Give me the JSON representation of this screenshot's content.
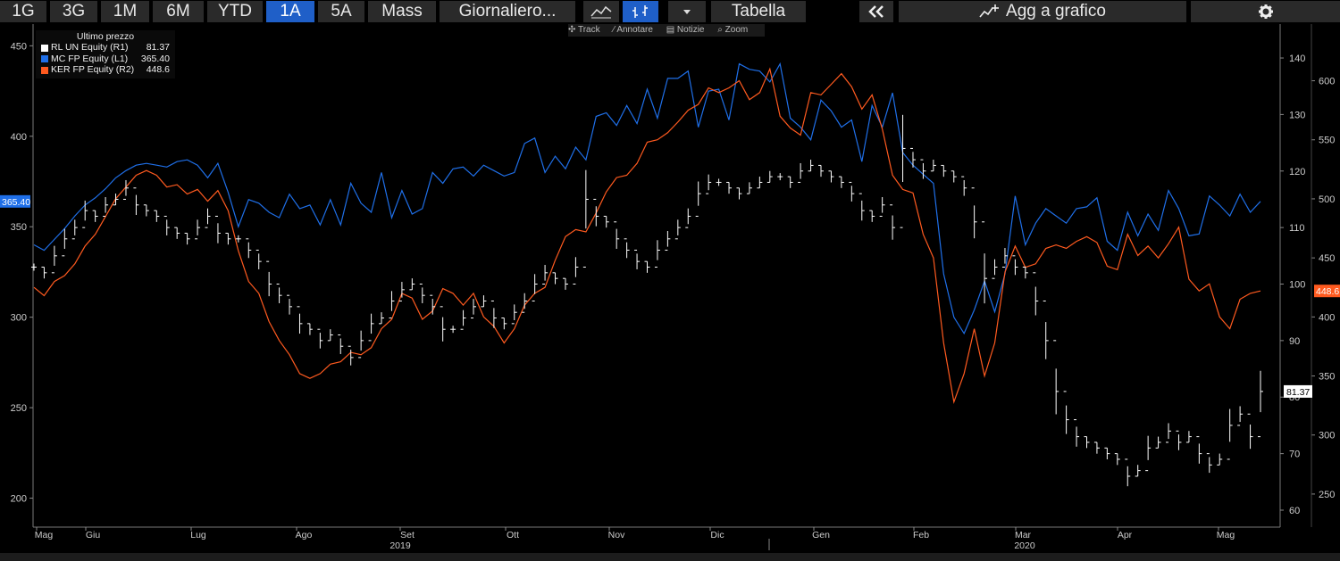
{
  "toolbar": {
    "buttons": [
      {
        "label": "1G"
      },
      {
        "label": "3G"
      },
      {
        "label": "1M"
      },
      {
        "label": "6M"
      },
      {
        "label": "YTD"
      },
      {
        "label": "1A",
        "active": true
      },
      {
        "label": "5A"
      },
      {
        "label": "Mass"
      },
      {
        "label": "Giornaliero..."
      }
    ],
    "icons": [
      "line-chart-icon",
      "bar-chart-icon",
      "dropdown-icon"
    ],
    "table_label": "Tabella",
    "collapse_icon": "double-chevron-left-icon",
    "add_chart_icon": "chart-add-icon",
    "add_chart_label": "Agg a grafico",
    "settings_icon": "gear-icon"
  },
  "subtools": [
    "Track",
    "Annotare",
    "Notizie",
    "Zoom"
  ],
  "legend": {
    "title": "Ultimo prezzo",
    "items": [
      {
        "name": "RL UN Equity  (R1)",
        "value": "81.37",
        "color": "#ffffff"
      },
      {
        "name": "MC FP Equity  (L1)",
        "value": "365.40",
        "color": "#1f6fe8"
      },
      {
        "name": "KER FP Equity  (R2)",
        "value": "448.6",
        "color": "#ff5a1f"
      }
    ]
  },
  "chart_data": {
    "type": "line",
    "x_labels": [
      "Mag",
      "Giu",
      "Lug",
      "Ago",
      "Set",
      "Ott",
      "Nov",
      "Dic",
      "Gen",
      "Feb",
      "Mar",
      "Apr",
      "Mag"
    ],
    "year_labels": [
      "2019",
      "2020"
    ],
    "left_axis": {
      "ticks": [
        200,
        250,
        300,
        350,
        400,
        450
      ],
      "ylim": [
        184,
        462
      ],
      "last_label": "365.40",
      "color": "#1f6fe8"
    },
    "right_axis_r1": {
      "ticks": [
        60,
        70,
        80,
        90,
        100,
        110,
        120,
        130,
        140
      ],
      "ylim": [
        57,
        146
      ],
      "last_label": "81.37"
    },
    "right_axis_r2": {
      "ticks": [
        250,
        300,
        350,
        400,
        450,
        500,
        550,
        600
      ],
      "ylim": [
        222,
        648
      ],
      "last_label": "448.6",
      "color": "#ff5a1f"
    },
    "series": [
      {
        "name": "MC FP Equity",
        "axis": "left",
        "color": "#1f6fe8",
        "values": [
          340,
          337,
          343,
          349,
          356,
          362,
          366,
          371,
          377,
          381,
          384,
          385,
          384,
          383,
          386,
          387,
          384,
          377,
          385,
          369,
          350,
          365,
          363,
          358,
          355,
          368,
          360,
          362,
          351,
          365,
          351,
          374,
          363,
          358,
          380,
          355,
          370,
          357,
          360,
          380,
          374,
          382,
          383,
          378,
          384,
          381,
          378,
          380,
          396,
          399,
          380,
          389,
          382,
          394,
          387,
          411,
          413,
          406,
          417,
          407,
          426,
          410,
          432,
          432,
          436,
          405,
          425,
          426,
          409,
          440,
          437,
          436,
          430,
          440,
          410,
          405,
          398,
          420,
          414,
          405,
          409,
          386,
          417,
          405,
          424,
          391,
          384,
          379,
          374,
          324,
          300,
          291,
          304,
          320,
          303,
          324,
          367,
          340,
          352,
          360,
          356,
          352,
          360,
          361,
          366,
          342,
          337,
          358,
          345,
          357,
          348,
          370,
          360,
          345,
          346,
          367,
          362,
          356,
          368,
          358,
          364
        ]
      },
      {
        "name": "KER FP Equity",
        "axis": "r2",
        "color": "#ff5a1f",
        "values": [
          425,
          418,
          430,
          435,
          445,
          460,
          470,
          485,
          500,
          510,
          520,
          524,
          520,
          510,
          512,
          504,
          508,
          498,
          507,
          490,
          456,
          430,
          420,
          396,
          380,
          368,
          352,
          348,
          352,
          360,
          362,
          370,
          368,
          374,
          390,
          398,
          420,
          416,
          398,
          405,
          424,
          420,
          410,
          420,
          400,
          392,
          378,
          390,
          410,
          420,
          425,
          448,
          468,
          474,
          472,
          488,
          506,
          518,
          520,
          530,
          548,
          550,
          556,
          565,
          575,
          580,
          594,
          590,
          594,
          600,
          584,
          590,
          610,
          570,
          560,
          554,
          590,
          588,
          597,
          606,
          595,
          576,
          588,
          559,
          520,
          508,
          505,
          470,
          450,
          378,
          328,
          352,
          390,
          350,
          378,
          438,
          460,
          442,
          445,
          458,
          461,
          458,
          464,
          468,
          463,
          443,
          440,
          470,
          452,
          460,
          450,
          462,
          476,
          432,
          422,
          428,
          400,
          390,
          415,
          420,
          422
        ]
      },
      {
        "name": "RL UN Equity",
        "axis": "r1",
        "color": "#ffffff",
        "values": [
          103,
          102,
          105,
          108,
          110,
          113,
          112,
          114,
          115,
          117,
          114,
          113,
          112,
          110,
          109,
          108,
          110,
          112,
          109,
          108,
          108,
          106,
          104,
          100,
          98,
          96,
          93,
          92,
          90,
          91,
          89,
          87,
          90,
          93,
          94,
          97,
          99,
          100,
          98,
          96,
          92,
          92,
          94,
          96,
          97,
          94,
          93,
          95,
          97,
          100,
          102,
          101,
          100,
          103,
          115,
          112,
          111,
          108,
          106,
          104,
          103,
          106,
          108,
          110,
          112,
          116,
          118,
          118,
          117,
          116,
          117,
          118,
          119,
          119,
          118,
          120,
          121,
          120,
          119,
          118,
          116,
          113,
          112,
          114,
          110,
          124,
          122,
          120,
          121,
          120,
          119,
          117,
          111,
          101,
          103,
          105,
          103,
          102,
          97,
          90,
          81,
          76,
          73,
          72,
          71,
          70,
          69,
          66,
          67,
          71,
          72,
          74,
          72,
          73,
          70,
          68,
          69,
          75,
          77,
          73,
          81
        ]
      }
    ]
  }
}
